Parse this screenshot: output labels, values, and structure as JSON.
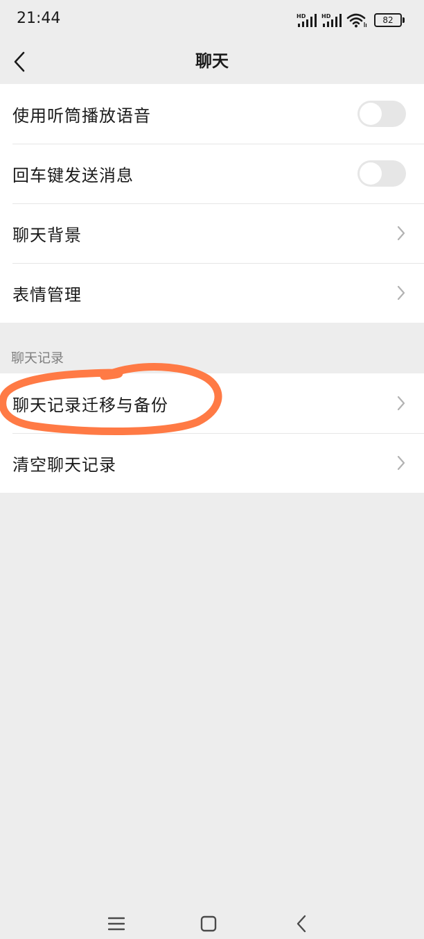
{
  "status_bar": {
    "time": "21:44",
    "battery": "82",
    "signal_1_label": "HD",
    "signal_2_label": "HD"
  },
  "nav": {
    "title": "聊天",
    "back_icon": "chevron-left-icon"
  },
  "settings_group_1": {
    "items": [
      {
        "label": "使用听筒播放语音",
        "control": "toggle",
        "enabled": false
      },
      {
        "label": "回车键发送消息",
        "control": "toggle",
        "enabled": false
      },
      {
        "label": "聊天背景",
        "control": "chevron"
      },
      {
        "label": "表情管理",
        "control": "chevron"
      }
    ]
  },
  "chat_history_section": {
    "header": "聊天记录",
    "items": [
      {
        "label": "聊天记录迁移与备份",
        "control": "chevron",
        "highlighted": true
      },
      {
        "label": "清空聊天记录",
        "control": "chevron"
      }
    ]
  },
  "colors": {
    "background": "#ededed",
    "card": "#ffffff",
    "toggle_off": "#e6e6e6",
    "annotation": "#ff7a45",
    "section_header": "#7f7f7f"
  },
  "system_nav": {
    "menu_icon": "menu-icon",
    "home_icon": "home-square-icon",
    "back_icon": "back-chevron-icon"
  }
}
